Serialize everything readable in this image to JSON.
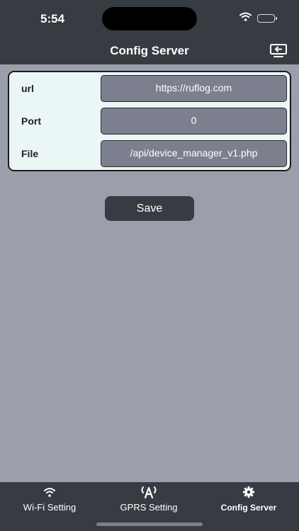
{
  "status_bar": {
    "time": "5:54"
  },
  "nav": {
    "title": "Config Server",
    "action_icon": "screen-share-icon"
  },
  "form": {
    "rows": [
      {
        "label": "url",
        "value": "https://ruflog.com"
      },
      {
        "label": "Port",
        "value": "0"
      },
      {
        "label": "File",
        "value": "/api/device_manager_v1.php"
      }
    ]
  },
  "save_label": "Save",
  "tabs": [
    {
      "label": "Wi-Fi Setting",
      "icon": "wifi-icon",
      "active": false
    },
    {
      "label": "GPRS Setting",
      "icon": "antenna-icon",
      "active": false
    },
    {
      "label": "Config Server",
      "icon": "gear-icon",
      "active": true
    }
  ],
  "colors": {
    "background": "#9b9fab",
    "bars": "#373b42",
    "card": "#ebf6f6",
    "field": "#7c808e"
  }
}
